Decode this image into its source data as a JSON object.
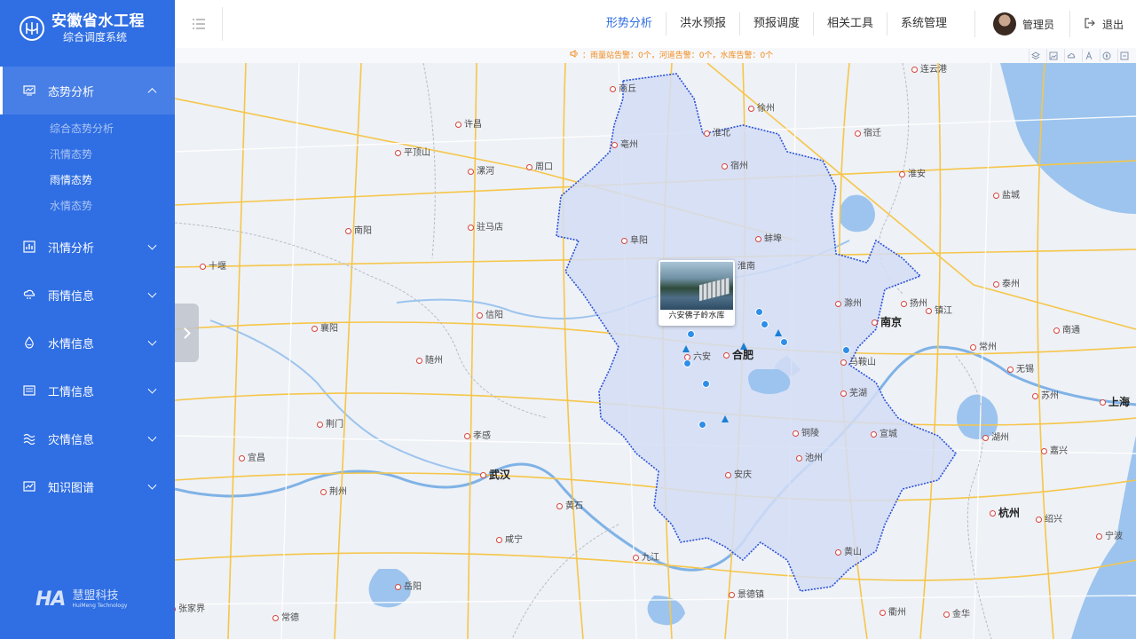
{
  "brand": {
    "title": "安徽省水工程",
    "subtitle": "综合调度系统",
    "logo_icon": "water-logo-icon"
  },
  "sidebar": {
    "items": [
      {
        "label": "态势分析",
        "icon": "monitor-chart-icon",
        "expanded": true,
        "children": [
          "综合态势分析",
          "汛情态势",
          "雨情态势",
          "水情态势"
        ],
        "current": "雨情态势"
      },
      {
        "label": "汛情分析",
        "icon": "chart-icon"
      },
      {
        "label": "雨情信息",
        "icon": "rain-cloud-icon"
      },
      {
        "label": "水情信息",
        "icon": "water-drop-icon"
      },
      {
        "label": "工情信息",
        "icon": "facility-icon"
      },
      {
        "label": "灾情信息",
        "icon": "wave-icon"
      },
      {
        "label": "知识图谱",
        "icon": "graph-icon"
      }
    ],
    "footer": {
      "mark": "HA",
      "name": "慧盟科技",
      "name_en": "HuiMeng Technology"
    }
  },
  "header": {
    "nav": [
      "形势分析",
      "洪水预报",
      "预报调度",
      "相关工具",
      "系统管理"
    ],
    "active_nav": "形势分析",
    "user": "管理员",
    "logout": "退出"
  },
  "alert": {
    "text": "：雨量站告警：0个，河道告警：0个，水库告警：0个"
  },
  "map": {
    "popup_label": "六安佛子岭水库",
    "province_cities": [
      "淮北",
      "亳州",
      "宿州",
      "阜阳",
      "蚌埠",
      "淮南",
      "六安",
      "合肥",
      "滁州",
      "马鞍山",
      "芜湖",
      "铜陵",
      "安庆",
      "宣城",
      "池州",
      "黄山"
    ],
    "other_cities": [
      "连云港",
      "徐州",
      "商丘",
      "许昌",
      "平顶山",
      "漯河",
      "周口",
      "驻马店",
      "南阳",
      "信阳",
      "十堰",
      "襄阳",
      "随州",
      "荆门",
      "孝感",
      "宜昌",
      "荆州",
      "咸宁",
      "黄石",
      "九江",
      "岳阳",
      "景德镇",
      "常德",
      "衢州",
      "金华",
      "宿迁",
      "淮安",
      "盐城",
      "泰州",
      "扬州",
      "镇江",
      "常州",
      "南通",
      "无锡",
      "苏州",
      "湖州",
      "嘉兴",
      "绍兴",
      "宁波",
      "张家界"
    ],
    "major_cities": [
      "南京",
      "合肥",
      "武汉",
      "杭州",
      "上海"
    ],
    "colors": {
      "province_fill": "#d4ddf5",
      "province_border": "#2a52d8",
      "water": "#9cc4ee",
      "highway": "#f6c64a",
      "road": "#ffffff",
      "land": "#eef1f6"
    }
  }
}
